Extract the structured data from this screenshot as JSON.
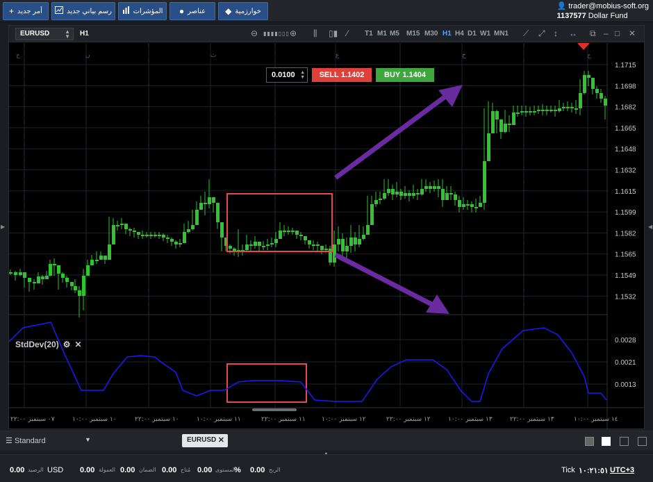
{
  "toolbar": {
    "new_order": "أمر جديد",
    "new_chart": "رسم بياني جديد",
    "indicators": "المؤشرات",
    "elements": "عناصر",
    "algorithms": "خوارزمية"
  },
  "account": {
    "user": "trader@mobius-soft.org",
    "number": "1137577",
    "fund": "Dollar Fund"
  },
  "chart": {
    "symbol": "EURUSD",
    "timeframe_current": "H1",
    "timeframes": [
      "T1",
      "M1",
      "M5",
      "M15",
      "M30",
      "H1",
      "H4",
      "D1",
      "W1",
      "MN1"
    ],
    "active_timeframe": "H1",
    "lot": "0.0100",
    "sell_label": "SELL",
    "sell_price": "1.1402",
    "buy_label": "BUY",
    "buy_price": "1.1404",
    "indicator": "StdDev(20)",
    "day_markers": [
      "ج",
      "ن",
      "ث",
      "ع",
      "خ",
      "ج",
      "ن"
    ],
    "price_ticks": [
      "1.1715",
      "1.1698",
      "1.1682",
      "1.1665",
      "1.1648",
      "1.1632",
      "1.1615",
      "1.1599",
      "1.1582",
      "1.1565",
      "1.1549",
      "1.1532"
    ],
    "ind_ticks": [
      "0.0028",
      "0.0021",
      "0.0013"
    ],
    "time_ticks": [
      "٠٧ سبتمبر ٢٢:٠٠",
      "١٠ سبتمبر ١٠:٠٠",
      "١٠ سبتمبر ٢٢:٠٠",
      "١١ سبتمبر ١٠:٠٠",
      "١١ سبتمبر ٢٢:٠٠",
      "١٢ سبتمبر ١٠:٠٠",
      "١٢ سبتمبر ٢٢:٠٠",
      "١٣ سبتمبر ١٠:٠٠",
      "١٣ سبتمبر ٢٢:٠٠",
      "١٤ سبتمبر ١٠:٠٠"
    ]
  },
  "tabs": {
    "layout": "Standard",
    "symbol_tab": "EURUSD"
  },
  "status": {
    "balance_label": "الرصيد",
    "balance": "0.00",
    "currency": "USD",
    "commission_label": "العمولة",
    "commission": "0.00",
    "margin_label": "الضمان",
    "margin": "0.00",
    "free_label": "مُتاح",
    "free": "0.00",
    "level_label": "المستوى",
    "level": "0.00",
    "level_unit": "%",
    "profit_label": "الربح",
    "profit": "0.00",
    "tick_label": "Tick",
    "time": "١٠:٢١:٥١",
    "tz": "UTC+3"
  },
  "colors": {
    "bull": "#2ec52e",
    "bear": "#2ec52e",
    "std_line": "#1a1aff",
    "highlight_box": "#e84a4a",
    "arrow": "#6a2aa0",
    "sell": "#e0403a",
    "buy": "#3fa63c"
  }
}
